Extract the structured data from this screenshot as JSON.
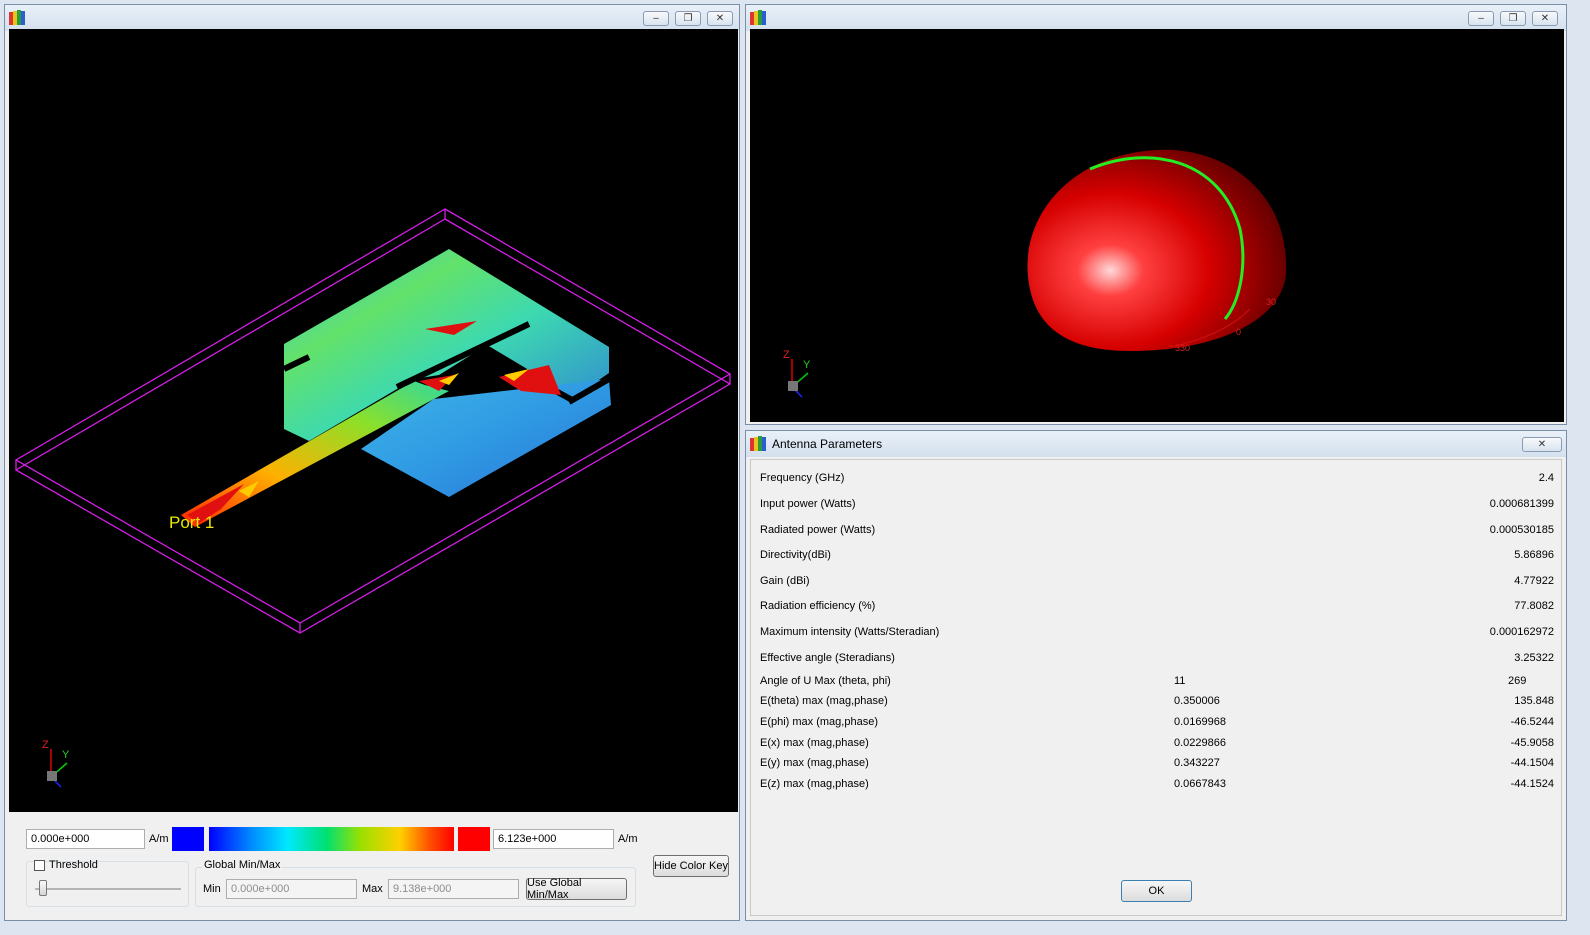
{
  "colors": {
    "min_swatch": "#0000ff",
    "max_swatch": "#ff0000",
    "bbox_lines": "#d21ee4",
    "port_label": "#e8e800"
  },
  "current_view": {
    "port_label": "Port 1",
    "axis_z": "Z",
    "axis_y": "Y"
  },
  "pattern_view": {
    "axis_z": "Z",
    "axis_y": "Y",
    "ticks": [
      "30",
      "0",
      "330"
    ]
  },
  "color_key": {
    "min_value": "0.000e+000",
    "min_unit": "A/m",
    "max_value": "6.123e+000",
    "max_unit": "A/m",
    "threshold_label": "Threshold",
    "threshold_checked": false,
    "global_group_label": "Global Min/Max",
    "global_min_label": "Min",
    "global_min_value": "0.000e+000",
    "global_max_label": "Max",
    "global_max_value": "9.138e+000",
    "use_global_button": "Use Global Min/Max",
    "hide_key_button": "Hide Color Key"
  },
  "antenna_dialog": {
    "title": "Antenna Parameters",
    "simple_rows": [
      {
        "label": "Frequency (GHz)",
        "value": "2.4"
      },
      {
        "label": "Input power (Watts)",
        "value": "0.000681399"
      },
      {
        "label": "Radiated power (Watts)",
        "value": "0.000530185"
      },
      {
        "label": "Directivity(dBi)",
        "value": "5.86896"
      },
      {
        "label": "Gain (dBi)",
        "value": "4.77922"
      },
      {
        "label": "Radiation efficiency (%)",
        "value": "77.8082"
      },
      {
        "label": "Maximum intensity (Watts/Steradian)",
        "value": "0.000162972"
      },
      {
        "label": "Effective angle (Steradians)",
        "value": "3.25322"
      }
    ],
    "pair_rows": [
      {
        "label": "Angle of U Max (theta, phi)",
        "v1": "11",
        "v2": "269"
      },
      {
        "label": "E(theta) max (mag,phase)",
        "v1": "0.350006",
        "v2": "135.848"
      },
      {
        "label": "E(phi) max (mag,phase)",
        "v1": "0.0169968",
        "v2": "-46.5244"
      },
      {
        "label": "E(x) max (mag,phase)",
        "v1": "0.0229866",
        "v2": "-45.9058"
      },
      {
        "label": "E(y) max (mag,phase)",
        "v1": "0.343227",
        "v2": "-44.1504"
      },
      {
        "label": "E(z) max (mag,phase)",
        "v1": "0.0667843",
        "v2": "-44.1524"
      }
    ],
    "ok_button": "OK"
  },
  "window_controls": {
    "minimize": "–",
    "restore": "❐",
    "close": "✕"
  }
}
